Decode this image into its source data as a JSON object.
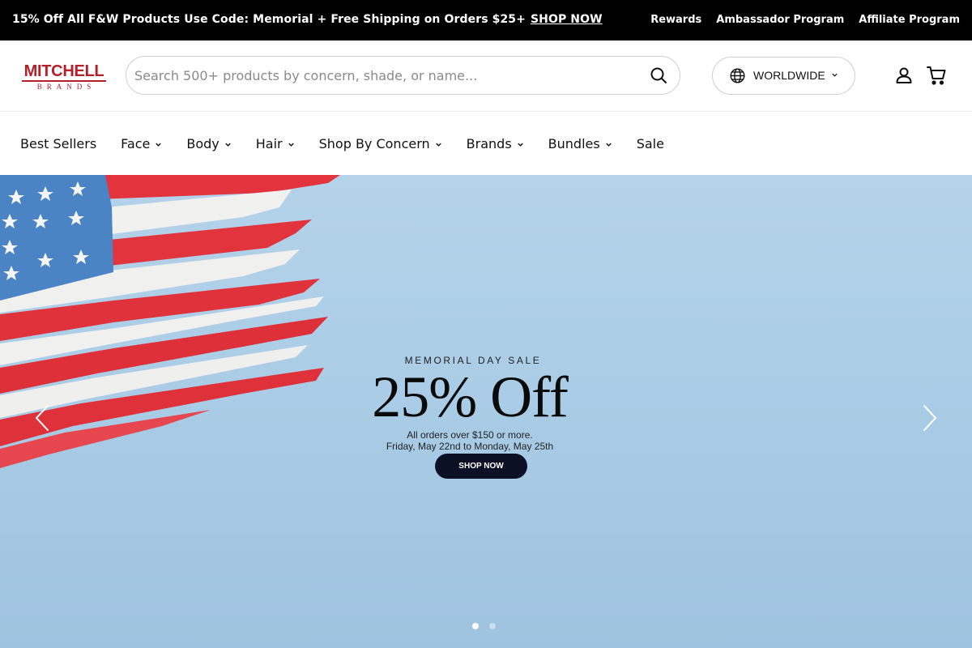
{
  "announcement": {
    "promo_text": "15% Off All F&W Products Use Code: Memorial + Free Shipping on Orders $25+",
    "promo_link": "SHOP NOW",
    "links": [
      "Rewards",
      "Ambassador Program",
      "Affiliate Program"
    ]
  },
  "header": {
    "logo_word": "MITCHELL",
    "logo_sub": "BRANDS",
    "search_placeholder": "Search 500+ products by concern, shade, or name...",
    "region_label": "WORLDWIDE"
  },
  "nav": {
    "items": [
      "Best Sellers",
      "Face",
      "Body",
      "Hair",
      "Shop By Concern",
      "Brands",
      "Bundles",
      "Sale"
    ]
  },
  "hero": {
    "eyebrow": "MEMORIAL DAY SALE",
    "headline": "25% Off",
    "detail_line1": "All orders over $150 or more.",
    "detail_line2": "Friday, May 22nd to Monday, May 25th",
    "cta": "SHOP NOW",
    "slide_count": 2,
    "active_slide": 1
  },
  "colors": {
    "brand_red": "#b3202a",
    "announcement_bg": "#000000",
    "hero_bg": "#a8cbe5",
    "cta_bg": "#0b1024"
  },
  "icons": [
    "search-icon",
    "globe-icon",
    "chevron-down-icon",
    "account-icon",
    "cart-icon",
    "chevron-left-icon",
    "chevron-right-icon"
  ]
}
